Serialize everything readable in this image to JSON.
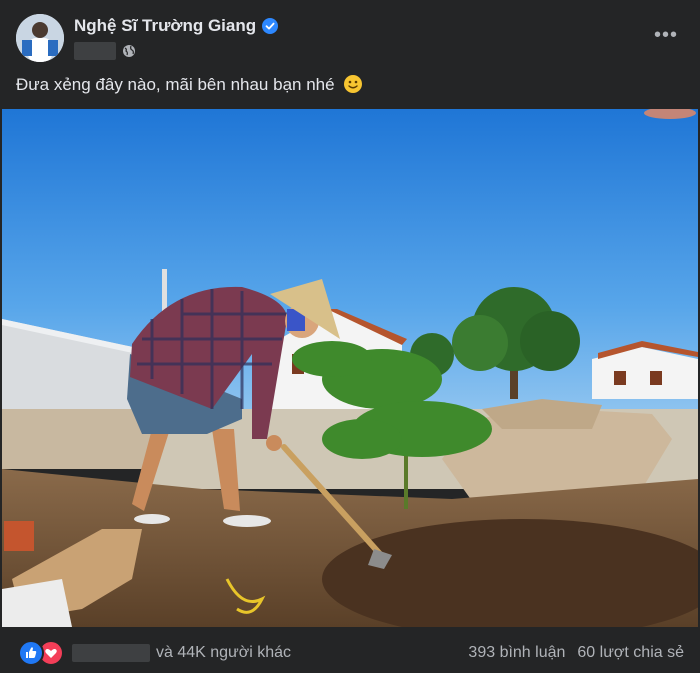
{
  "post": {
    "author_name": "Nghệ Sĩ Trường Giang",
    "caption": "Đưa xẻng đây nào, mãi bên nhau bạn nhé",
    "more_label": "•••",
    "icons": {
      "verified": "verified-badge-icon",
      "privacy": "globe-icon",
      "emoji": "slightly-smiling-face-icon",
      "like": "like-reaction-icon",
      "love": "love-reaction-icon"
    }
  },
  "footer": {
    "others_text": "và 44K người khác",
    "comments_text": "393 bình luận",
    "shares_text": "60 lượt chia sẻ"
  },
  "colors": {
    "background": "#242526",
    "text": "#e4e6eb",
    "muted": "#b0b3b8",
    "verified_blue": "#2d88ff",
    "like_blue": "#2078f4",
    "love_red": "#f33e58"
  }
}
